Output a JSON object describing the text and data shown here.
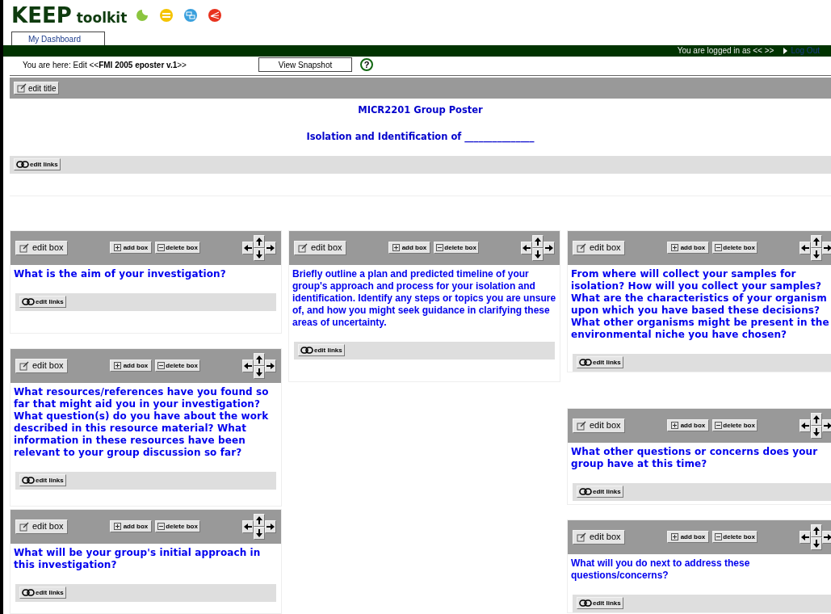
{
  "logo": {
    "brand": "KEEP",
    "product": "toolkit"
  },
  "tabs": [
    {
      "label": "My Dashboard",
      "selected": true
    }
  ],
  "login": {
    "text": "You are logged in as << >>",
    "link": "Log Out"
  },
  "breadcrumb": {
    "text": "You are here: Edit <<**FMI 2005 eposter v.1**>>",
    "button": "View Snapshot",
    "help": "?"
  },
  "title_section": {
    "edit_button": "edit title",
    "title": "MICR2201 Group Poster",
    "subtitle": "Isolation and Identification of _______________",
    "links_button": "edit links"
  },
  "columns": [
    {
      "boxes": [
        {
          "kind": "wide",
          "question": "What is the aim of your investigation?",
          "edit": "edit box",
          "add": "add box",
          "delete": "delete box",
          "links": "edit links"
        },
        {
          "kind": "wide",
          "question": "What resources/references have you found so far that might aid you in your investigation? What question(s) do you have about the work described in this resource material? What information in these resources have been relevant to your group discussion so far?",
          "edit": "edit box",
          "add": "add box",
          "delete": "delete box",
          "links": "edit links"
        },
        {
          "kind": "wide",
          "question": "What will be your group's initial approach in this investigation?",
          "edit": "edit box",
          "add": "add box",
          "delete": "delete box",
          "links": "edit links"
        }
      ]
    },
    {
      "boxes": [
        {
          "kind": "narrow",
          "question": "Briefly outline a plan and predicted timeline of your group's approach and process for your isolation and identification. Identify any steps or topics you are unsure of, and how you might seek guidance in clarifying these areas of uncertainty.",
          "edit": "edit box",
          "add": "add box",
          "delete": "delete box",
          "links": "edit links"
        }
      ]
    },
    {
      "boxes": [
        {
          "kind": "wide",
          "question": "From where will collect your samples for isolation? How will you collect your samples? What are the characteristics of your organism upon which you have based these decisions? What other organisms might be present in the environmental niche you have chosen?",
          "edit": "edit box",
          "add": "add box",
          "delete": "delete box",
          "links": "edit links"
        },
        {
          "kind": "wide",
          "question": "What other questions or concerns does your group have at this time?",
          "edit": "edit box",
          "add": "add box",
          "delete": "delete box",
          "links": "edit links"
        },
        {
          "kind": "narrow",
          "question": "What will you do next to address these questions/concerns?",
          "edit": "edit box",
          "add": "add box",
          "delete": "delete box",
          "links": "edit links"
        }
      ]
    }
  ]
}
